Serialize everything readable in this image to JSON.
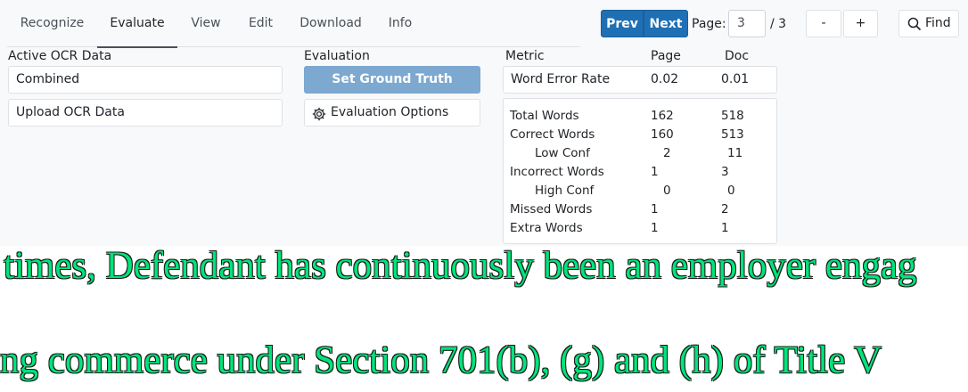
{
  "tabs": [
    "Recognize",
    "Evaluate",
    "View",
    "Edit",
    "Download",
    "Info"
  ],
  "nav": {
    "prev_label": "Prev",
    "next_label": "Next",
    "page_label": "Page:",
    "page_value": "3",
    "page_total": "/ 3",
    "zoom_out_label": "-",
    "zoom_in_label": "+",
    "find_label": "Find"
  },
  "ocr": {
    "section_label": "Active OCR Data",
    "active_value": "Combined",
    "upload_label": "Upload OCR Data"
  },
  "evaluation": {
    "section_label": "Evaluation",
    "ground_truth_label": "Set Ground Truth",
    "options_label": "Evaluation Options"
  },
  "metric": {
    "header_metric": "Metric",
    "header_page": "Page",
    "header_doc": "Doc",
    "wer_label": "Word Error Rate",
    "wer_page": "0.02",
    "wer_doc": "0.01"
  },
  "stats": [
    {
      "label": "Total Words",
      "page": "162",
      "doc": "518"
    },
    {
      "label": "Correct Words",
      "page": "160",
      "doc": "513"
    },
    {
      "label": "Low Conf",
      "page": "2",
      "doc": "11"
    },
    {
      "label": "Incorrect Words",
      "page": "1",
      "doc": "3"
    },
    {
      "label": "High Conf",
      "page": "0",
      "doc": "0"
    },
    {
      "label": "Missed Words",
      "page": "1",
      "doc": "2"
    },
    {
      "label": "Extra Words",
      "page": "1",
      "doc": "1"
    }
  ],
  "document": {
    "line1": "times, Defendant has continuously been an employer engag",
    "line2": "ng commerce under Section 701(b), (g) and (h) of Title V"
  },
  "colors": {
    "primary": "#1f6fb5",
    "ground_truth_button": "#7da8cf",
    "ocr_text": "#00e57a"
  }
}
